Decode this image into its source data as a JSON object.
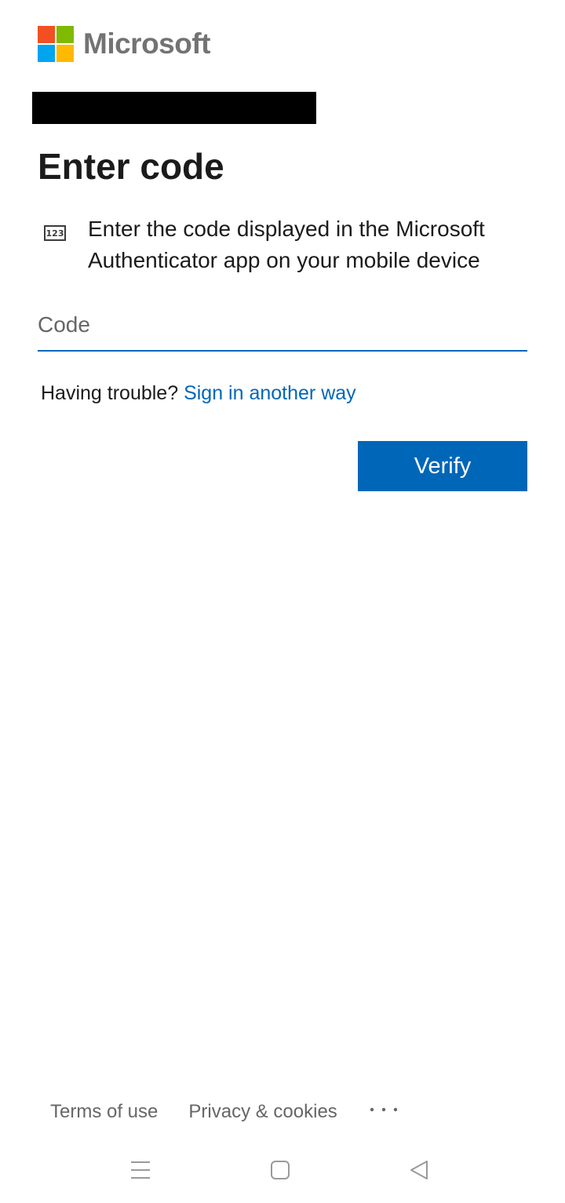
{
  "brand": {
    "name": "Microsoft",
    "logo_colors": [
      "#f25022",
      "#7fba00",
      "#00a4ef",
      "#ffb900"
    ]
  },
  "page": {
    "title": "Enter code",
    "description": "Enter the code displayed in the Microsoft Authenticator app on your mobile device",
    "code_icon_text": "123"
  },
  "form": {
    "code_placeholder": "Code",
    "code_value": "",
    "trouble_text": "Having trouble?",
    "alt_signin_link": "Sign in another way",
    "verify_label": "Verify"
  },
  "footer": {
    "terms": "Terms of use",
    "privacy": "Privacy & cookies",
    "more": "..."
  },
  "colors": {
    "accent": "#0067b8",
    "text": "#1b1b1b",
    "muted": "#666666"
  },
  "system_nav": {
    "icons": [
      "menu-icon",
      "home-icon",
      "back-icon"
    ]
  }
}
